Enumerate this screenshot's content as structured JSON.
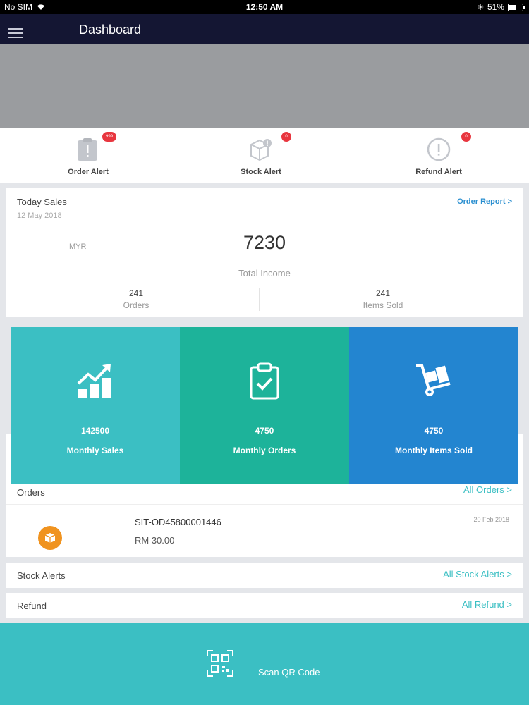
{
  "status_bar": {
    "carrier": "No SIM",
    "time": "12:50 AM",
    "battery": "51%"
  },
  "header": {
    "title": "Dashboard",
    "menu_icon": "hamburger-icon"
  },
  "alerts": [
    {
      "label": "Order Alert",
      "badge": "999",
      "icon": "clipboard-alert-icon"
    },
    {
      "label": "Stock Alert",
      "badge": "0",
      "icon": "box-alert-icon"
    },
    {
      "label": "Refund Alert",
      "badge": "0",
      "icon": "exclamation-circle-icon"
    }
  ],
  "today_sales": {
    "title": "Today Sales",
    "date": "12 May 2018",
    "report_link": "Order Report >",
    "currency": "MYR",
    "total_income": "7230",
    "total_income_label": "Total Income",
    "orders_value": "241",
    "orders_label": "Orders",
    "items_value": "241",
    "items_label": "Items Sold"
  },
  "tiles": [
    {
      "value": "142500",
      "label": "Monthly Sales",
      "color": "#3bbfc3",
      "icon": "growth-chart-icon"
    },
    {
      "value": "4750",
      "label": "Monthly Orders",
      "color": "#1db39a",
      "icon": "clipboard-check-icon"
    },
    {
      "value": "4750",
      "label": "Monthly Items Sold",
      "color": "#2385d0",
      "icon": "hand-truck-icon"
    }
  ],
  "orders": {
    "title": "Orders",
    "all_link": "All Orders >",
    "items": [
      {
        "id": "SIT-OD45800001446",
        "price": "RM 30.00",
        "date": "20 Feb 2018",
        "icon": "package-icon"
      }
    ]
  },
  "stock_alerts": {
    "title": "Stock Alerts",
    "all_link": "All Stock Alerts >"
  },
  "refund": {
    "title": "Refund",
    "all_link": "All Refund >"
  },
  "scan": {
    "label": "Scan QR Code",
    "icon": "qr-code-icon"
  },
  "colors": {
    "nav": "#141633",
    "accent": "#3bbfc3",
    "link": "#2a8fd0",
    "badge": "#e8363f"
  }
}
